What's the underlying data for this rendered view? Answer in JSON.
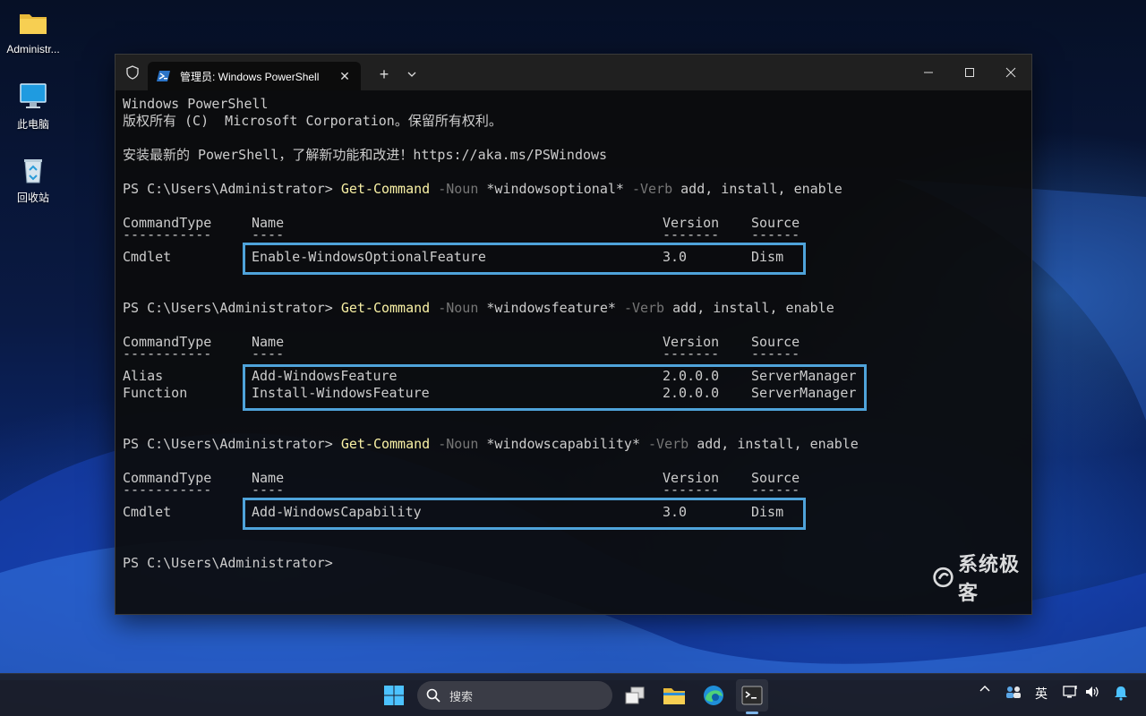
{
  "desktop": {
    "icons": [
      {
        "label": "Administr...",
        "icon": "folder-icon"
      },
      {
        "label": "此电脑",
        "icon": "computer-icon"
      },
      {
        "label": "回收站",
        "icon": "recycle-bin-icon"
      }
    ]
  },
  "window": {
    "tab_title": "管理员: Windows PowerShell",
    "new_tab_label": "+",
    "controls": [
      "minimize",
      "maximize",
      "close"
    ]
  },
  "console": {
    "banner": [
      "Windows PowerShell",
      "版权所有 (C)  Microsoft Corporation。保留所有权利。",
      "安装最新的 PowerShell，了解新功能和改进！https://aka.ms/PSWindows"
    ],
    "prompt": "PS C:\\Users\\Administrator> ",
    "headers": {
      "type": "CommandType",
      "name": "Name",
      "version": "Version",
      "source": "Source"
    },
    "dashes": {
      "type": "-----------",
      "name": "----",
      "version": "-------",
      "source": "------"
    },
    "commands": [
      {
        "cmd": "Get-Command",
        "noun_param": "-Noun",
        "noun_value": "*windowsoptional*",
        "verb_param": "-Verb",
        "verb_value": "add, install, enable",
        "rows": [
          {
            "type": "Cmdlet",
            "name": "Enable-WindowsOptionalFeature",
            "version": "3.0",
            "source": "Dism"
          }
        ]
      },
      {
        "cmd": "Get-Command",
        "noun_param": "-Noun",
        "noun_value": "*windowsfeature*",
        "verb_param": "-Verb",
        "verb_value": "add, install, enable",
        "rows": [
          {
            "type": "Alias",
            "name": "Add-WindowsFeature",
            "version": "2.0.0.0",
            "source": "ServerManager"
          },
          {
            "type": "Function",
            "name": "Install-WindowsFeature",
            "version": "2.0.0.0",
            "source": "ServerManager"
          }
        ]
      },
      {
        "cmd": "Get-Command",
        "noun_param": "-Noun",
        "noun_value": "*windowscapability*",
        "verb_param": "-Verb",
        "verb_value": "add, install, enable",
        "rows": [
          {
            "type": "Cmdlet",
            "name": "Add-WindowsCapability",
            "version": "3.0",
            "source": "Dism"
          }
        ]
      }
    ]
  },
  "watermark": "系统极客",
  "taskbar": {
    "search_placeholder": "搜索",
    "ime_label": "英",
    "apps": [
      "start-icon",
      "task-view-icon",
      "file-explorer-icon",
      "edge-icon",
      "terminal-icon"
    ]
  },
  "colors": {
    "highlight_box": "#4fa3da",
    "command": "#f9f1a5",
    "parameter": "#767676",
    "text": "#cccccc"
  }
}
